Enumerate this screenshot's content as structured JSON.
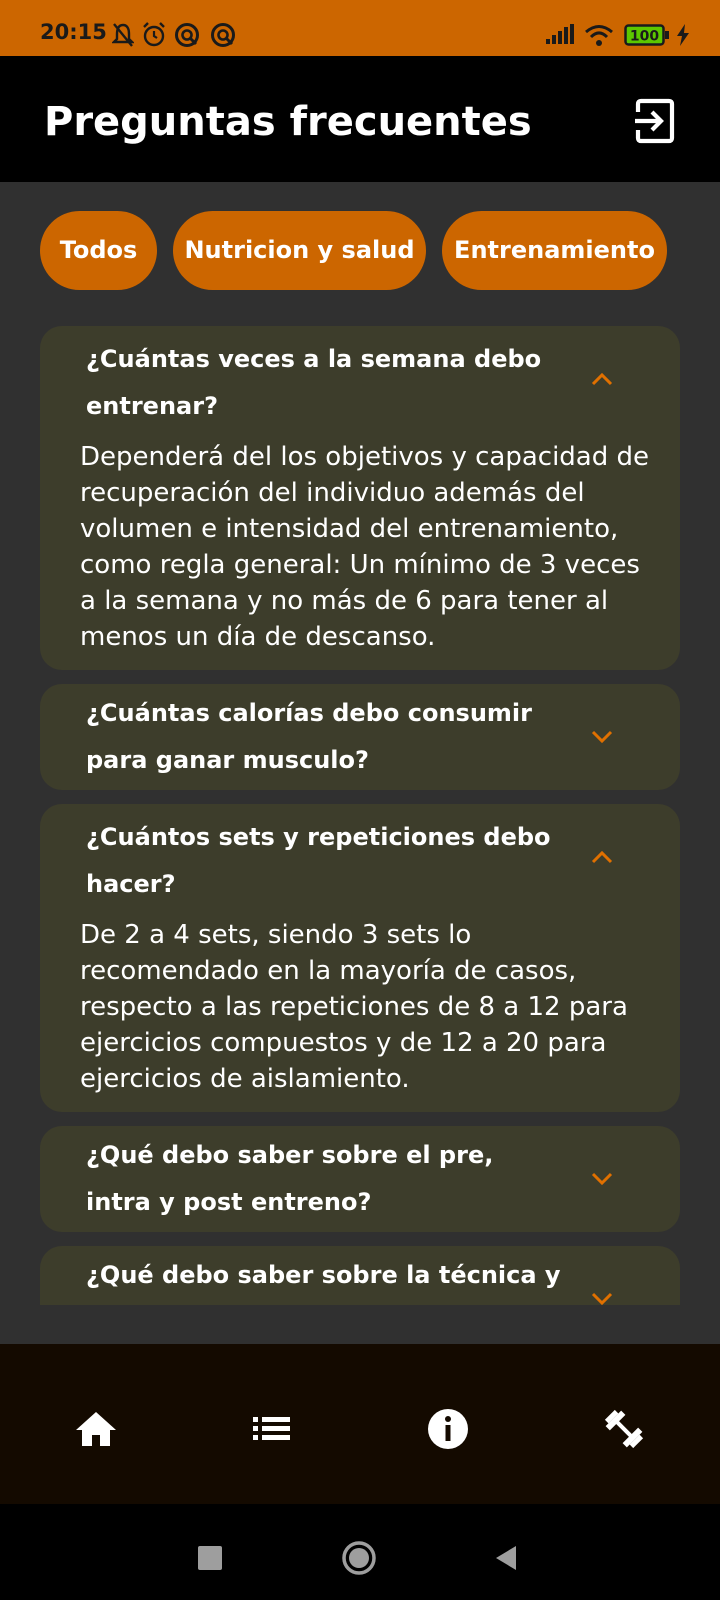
{
  "status_bar": {
    "time": "20:15",
    "battery": "100",
    "icons": [
      "mute-icon",
      "alarm-icon",
      "dnd-icon",
      "dnd-icon",
      "signal-icon",
      "wifi-icon",
      "battery-icon",
      "charging-icon"
    ]
  },
  "app_bar": {
    "title": "Preguntas frecuentes",
    "exit_icon": "logout-icon"
  },
  "filters": [
    {
      "label": "Todos"
    },
    {
      "label": "Nutricion y salud"
    },
    {
      "label": "Entrenamiento"
    }
  ],
  "faqs": [
    {
      "question": "¿Cuántas veces a la semana debo entrenar?",
      "expanded": true,
      "answer": "Dependerá del los objetivos y capacidad de recuperación del individuo además del volumen e intensidad del entrenamiento, como regla general: Un mínimo de 3 veces a la semana y no más de 6 para tener al menos un día de descanso."
    },
    {
      "question": "¿Cuántas calorías debo consumir para ganar musculo?",
      "expanded": false
    },
    {
      "question": "¿Cuántos sets y repeticiones debo hacer?",
      "expanded": true,
      "answer": "De 2 a 4 sets, siendo 3 sets lo recomendado en la mayoría de casos, respecto a las repeticiones de 8 a 12 para ejercicios compuestos y de 12 a 20 para ejercicios de aislamiento."
    },
    {
      "question": "¿Qué debo saber sobre el pre, intra y post entreno?",
      "expanded": false
    },
    {
      "question": "¿Qué debo saber sobre la técnica y",
      "expanded": false
    }
  ],
  "bottom_nav": [
    "home-icon",
    "list-icon",
    "info-icon",
    "dumbbell-icon"
  ],
  "system_nav": [
    "recents-icon",
    "home-circle-icon",
    "back-icon"
  ],
  "colors": {
    "accent": "#cc6600",
    "card": "#3d3d2b",
    "background": "#303030",
    "bottom_nav": "#140a00"
  }
}
